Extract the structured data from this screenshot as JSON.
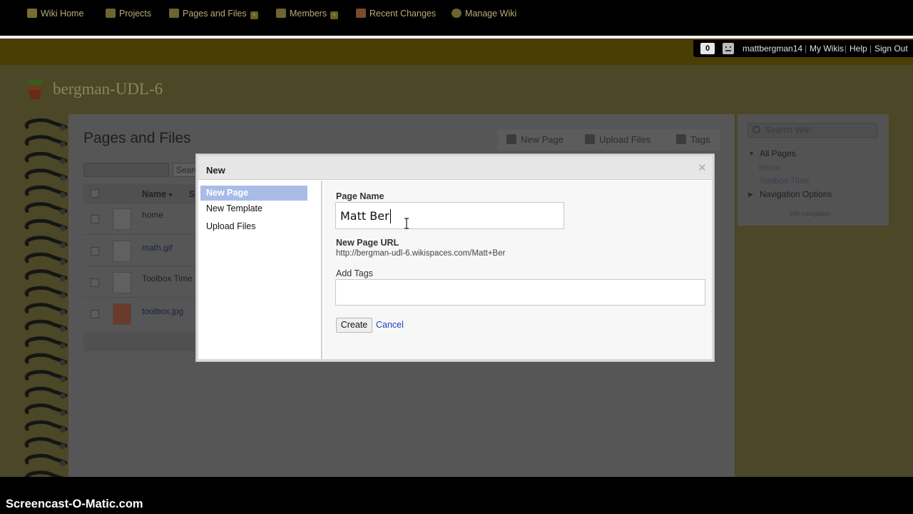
{
  "nav": {
    "items": [
      {
        "label": "Wiki Home",
        "icon": "home-icon",
        "has_plus": false
      },
      {
        "label": "Projects",
        "icon": "projects-icon",
        "has_plus": false
      },
      {
        "label": "Pages and Files",
        "icon": "pages-icon",
        "has_plus": true
      },
      {
        "label": "Members",
        "icon": "members-icon",
        "has_plus": true
      },
      {
        "label": "Recent Changes",
        "icon": "calendar-icon",
        "has_plus": false
      },
      {
        "label": "Manage Wiki",
        "icon": "gear-icon",
        "has_plus": false
      }
    ],
    "plus_symbol": "+"
  },
  "user_bar": {
    "message_count": "0",
    "username": "mattbergman14",
    "my_wikis": "My Wikis",
    "help": "Help",
    "sign_out": "Sign Out",
    "separator": "|"
  },
  "wiki": {
    "title": "bergman-UDL-6"
  },
  "background_page": {
    "title": "Pages and Files",
    "actions": [
      "New Page",
      "Upload Files",
      "Tags"
    ],
    "search_button": "Search",
    "columns": {
      "name": "Name",
      "sort_indicator": "▾",
      "second": "S"
    },
    "files": [
      "home",
      "math.gif",
      "Toolbox Time",
      "toolbox.jpg"
    ]
  },
  "sidebar": {
    "search_placeholder": "Search Wiki",
    "all_pages": "All Pages",
    "pages": [
      "home",
      "Toolbox Time"
    ],
    "navigation_options": "Navigation Options",
    "edit_navigation": "edit navigation"
  },
  "modal": {
    "title": "New",
    "close_symbol": "✕",
    "menu": [
      "New Page",
      "New Template",
      "Upload Files"
    ],
    "active_menu_index": 0,
    "page_name_label": "Page Name",
    "page_name_value": "Matt Ber",
    "url_label": "New Page URL",
    "url_value": "http://bergman-udl-6.wikispaces.com/Matt+Ber",
    "tags_label": "Add Tags",
    "tags_value": "",
    "create_label": "Create",
    "cancel_label": "Cancel"
  },
  "watermark": "Screencast-O-Matic.com",
  "colors": {
    "nav_bg": "#4a3e05",
    "modal_active": "#a9bce8",
    "link": "#1f3ec2"
  }
}
